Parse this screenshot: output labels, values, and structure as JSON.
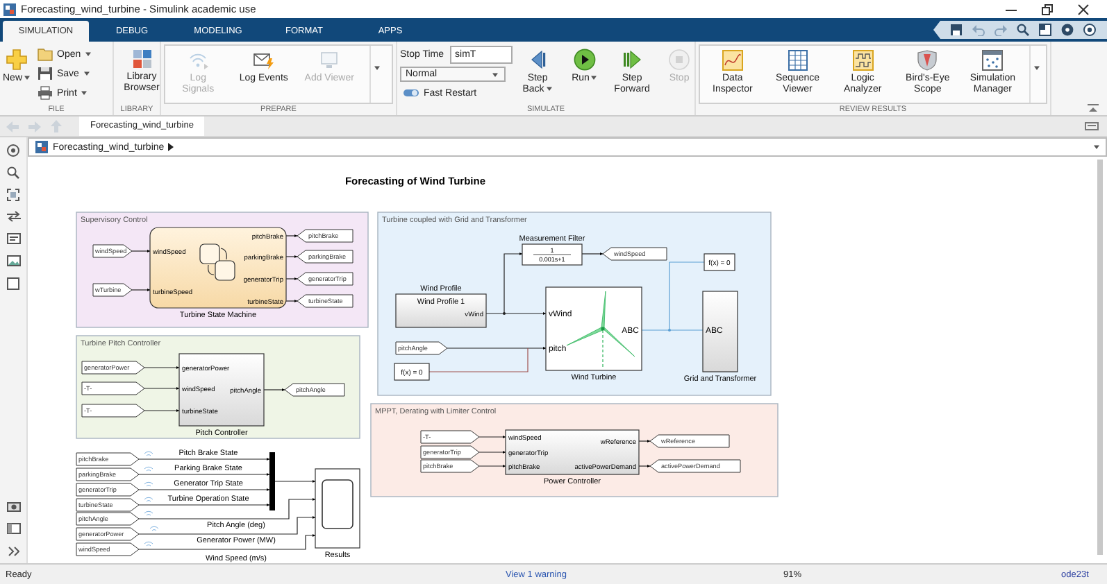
{
  "window": {
    "title": "Forecasting_wind_turbine - Simulink academic use"
  },
  "ribbon": {
    "tabs": [
      {
        "label": "SIMULATION",
        "selected": true
      },
      {
        "label": "DEBUG",
        "selected": false
      },
      {
        "label": "MODELING",
        "selected": false
      },
      {
        "label": "FORMAT",
        "selected": false
      },
      {
        "label": "APPS",
        "selected": false
      }
    ],
    "groups": [
      {
        "label": "FILE",
        "gallery": false,
        "items": [
          {
            "kind": "large",
            "label": "New",
            "menu": true,
            "disabled": false
          },
          {
            "kind": "small",
            "label": "Open",
            "menu": true,
            "disabled": false
          },
          {
            "kind": "small",
            "label": "Save",
            "menu": true,
            "disabled": false
          },
          {
            "kind": "small",
            "label": "Print",
            "menu": true,
            "disabled": false
          }
        ]
      },
      {
        "label": "LIBRARY",
        "gallery": false,
        "items": [
          {
            "kind": "large",
            "label": "Library Browser",
            "menu": false,
            "disabled": false
          }
        ]
      },
      {
        "label": "PREPARE",
        "gallery": true,
        "items": [
          {
            "kind": "large",
            "label": "Log Signals",
            "menu": false,
            "disabled": true
          },
          {
            "kind": "large",
            "label": "Log Events",
            "menu": false,
            "disabled": false
          },
          {
            "kind": "large",
            "label": "Add Viewer",
            "menu": false,
            "disabled": true
          }
        ]
      },
      {
        "label": "SIMULATE",
        "gallery": false,
        "items": [
          {
            "kind": "field",
            "label": "Stop Time",
            "value": "simT",
            "disabled": false
          },
          {
            "kind": "dropdown",
            "value": "Normal",
            "menu": true,
            "disabled": false
          },
          {
            "kind": "small",
            "label": "Fast Restart",
            "menu": false,
            "disabled": false
          },
          {
            "kind": "large",
            "label": "Step Back",
            "menu": true,
            "disabled": false
          },
          {
            "kind": "large",
            "label": "Run",
            "menu": true,
            "disabled": false
          },
          {
            "kind": "large",
            "label": "Step Forward",
            "menu": false,
            "disabled": false
          },
          {
            "kind": "large",
            "label": "Stop",
            "menu": false,
            "disabled": true
          }
        ]
      },
      {
        "label": "REVIEW RESULTS",
        "gallery": true,
        "items": [
          {
            "kind": "large",
            "label": "Data Inspector",
            "menu": false,
            "disabled": false
          },
          {
            "kind": "large",
            "label": "Sequence Viewer",
            "menu": false,
            "disabled": false
          },
          {
            "kind": "large",
            "label": "Logic Analyzer",
            "menu": false,
            "disabled": false
          },
          {
            "kind": "large",
            "label": "Bird's-Eye Scope",
            "menu": false,
            "disabled": false
          },
          {
            "kind": "large",
            "label": "Simulation Manager",
            "menu": false,
            "disabled": false
          }
        ]
      }
    ]
  },
  "explorer_bar": {
    "tab": "Forecasting_wind_turbine"
  },
  "address_bar": {
    "path": "Forecasting_wind_turbine"
  },
  "diagram": {
    "title": "Forecasting of Wind Turbine",
    "areas": [
      {
        "label": "Supervisory Control",
        "color": "#f4e7f6"
      },
      {
        "label": "Turbine Pitch Controller",
        "color": "#eff5e6"
      },
      {
        "label": "Turbine coupled with Grid and Transformer",
        "color": "#e5f1fb"
      },
      {
        "label": "MPPT, Derating with Limiter Control",
        "color": "#fcebe6"
      }
    ],
    "blocks": [
      {
        "kind": "chart",
        "name": "Turbine State Machine",
        "inputs": [
          "windSpeed",
          "turbineSpeed"
        ],
        "outputs": [
          "pitchBrake",
          "parkingBrake",
          "generatorTrip",
          "turbineState"
        ]
      },
      {
        "kind": "subsystem",
        "name": "Pitch Controller",
        "inputs": [
          "generatorPower",
          "windSpeed",
          "turbineState"
        ],
        "outputs": [
          "pitchAngle"
        ]
      },
      {
        "kind": "transfer_fcn",
        "name": "Measurement Filter",
        "numerator": "1",
        "denominator": "0.001s+1"
      },
      {
        "kind": "solver",
        "text": "f(x) = 0"
      },
      {
        "kind": "signal_builder",
        "name": "Wind Profile",
        "text": "Wind Profile 1",
        "outputs": [
          "vWind"
        ]
      },
      {
        "kind": "solver",
        "text": "f(x) = 0"
      },
      {
        "kind": "turbine",
        "name": "Wind Turbine",
        "inputs": [
          "vWind",
          "pitch"
        ],
        "outputs": [
          "ABC"
        ]
      },
      {
        "kind": "grid",
        "name": "Grid and Transformer",
        "inputs": [
          "ABC"
        ]
      },
      {
        "kind": "subsystem",
        "name": "Power Controller",
        "inputs": [
          "windSpeed",
          "generatorTrip",
          "pitchBrake"
        ],
        "outputs": [
          "wReference",
          "activePowerDemand"
        ]
      },
      {
        "kind": "scope",
        "name": "Results"
      }
    ],
    "tags": [
      {
        "kind": "from",
        "label": "windSpeed"
      },
      {
        "kind": "from",
        "label": "wTurbine"
      },
      {
        "kind": "goto",
        "label": "pitchBrake"
      },
      {
        "kind": "goto",
        "label": "parkingBrake"
      },
      {
        "kind": "goto",
        "label": "generatorTrip"
      },
      {
        "kind": "goto",
        "label": "turbineState"
      },
      {
        "kind": "from",
        "label": "generatorPower"
      },
      {
        "kind": "from",
        "label": "-T-"
      },
      {
        "kind": "from",
        "label": "-T-"
      },
      {
        "kind": "goto",
        "label": "pitchAngle"
      },
      {
        "kind": "goto",
        "label": "windSpeed"
      },
      {
        "kind": "from",
        "label": "pitchAngle"
      },
      {
        "kind": "from",
        "label": "-T-"
      },
      {
        "kind": "from",
        "label": "generatorTrip"
      },
      {
        "kind": "from",
        "label": "pitchBrake"
      },
      {
        "kind": "goto",
        "label": "wReference"
      },
      {
        "kind": "goto",
        "label": "activePowerDemand"
      },
      {
        "kind": "from",
        "label": "pitchBrake"
      },
      {
        "kind": "from",
        "label": "parkingBrake"
      },
      {
        "kind": "from",
        "label": "generatorTrip"
      },
      {
        "kind": "from",
        "label": "turbineState"
      },
      {
        "kind": "from",
        "label": "pitchAngle"
      },
      {
        "kind": "from",
        "label": "generatorPower"
      },
      {
        "kind": "from",
        "label": "windSpeed"
      }
    ],
    "signal_labels": [
      "Pitch Brake State",
      "Parking Brake State",
      "Generator Trip State",
      "Turbine Operation State",
      "Pitch Angle (deg)",
      "Generator Power (MW)",
      "Wind Speed (m/s)"
    ]
  },
  "status_bar": {
    "state": "Ready",
    "warning": "View 1 warning",
    "zoom": "91%",
    "solver": "ode23t"
  }
}
